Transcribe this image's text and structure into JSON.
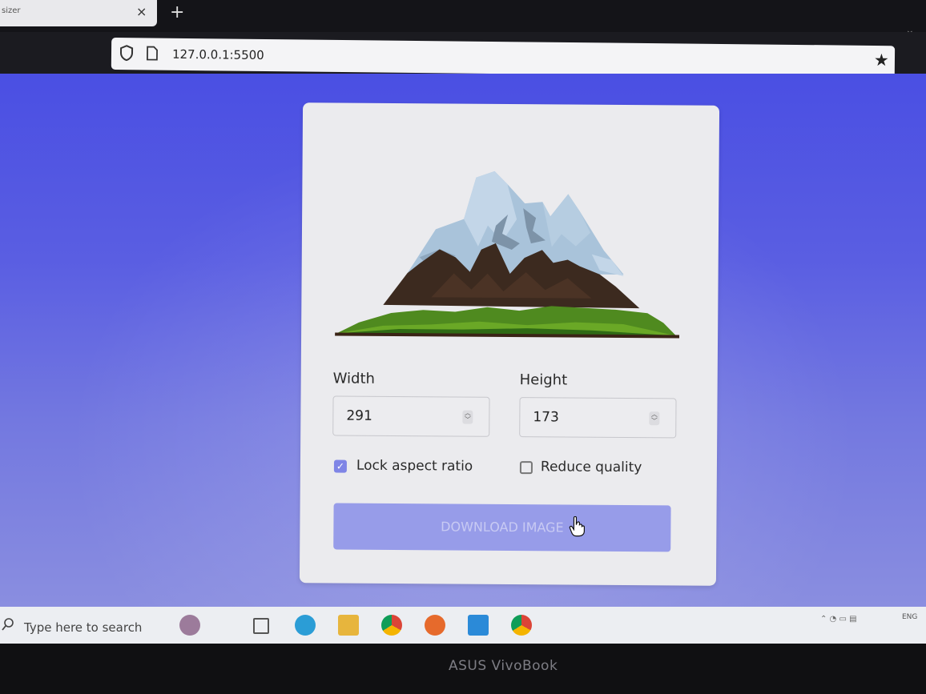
{
  "browser": {
    "tab_title": "sizer",
    "tab_close": "×",
    "new_tab": "+",
    "url": "127.0.0.1:5500"
  },
  "form": {
    "width_label": "Width",
    "width_value": "291",
    "height_label": "Height",
    "height_value": "173",
    "lock_aspect_label": "Lock aspect ratio",
    "lock_aspect_checked": true,
    "reduce_quality_label": "Reduce quality",
    "reduce_quality_checked": false,
    "download_label": "DOWNLOAD IMAGE"
  },
  "taskbar": {
    "search_placeholder": "Type here to search",
    "language": "ENG"
  },
  "device_brand": "ASUS VivoBook",
  "colors": {
    "background": "#4a4fe3",
    "card": "#ebebee",
    "button": "#979ce9",
    "checkbox_accent": "#7f85e6"
  }
}
